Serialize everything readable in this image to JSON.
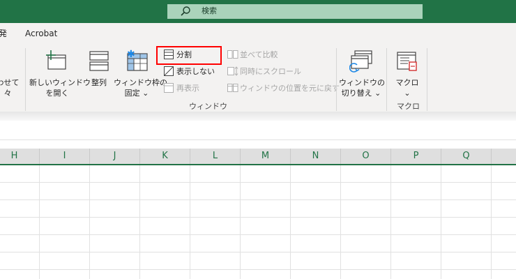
{
  "titlebar": {
    "search_placeholder": "検索",
    "search_icon": "search-icon"
  },
  "menu": {
    "partial_left": "発",
    "acrobat": "Acrobat"
  },
  "ribbon": {
    "partial_left": {
      "line1": "わせて",
      "line2": "々"
    },
    "new_window": {
      "line1": "新しいウィンドウ",
      "line2": "を開く"
    },
    "arrange": {
      "label": "整列"
    },
    "freeze_panes": {
      "line1": "ウィンドウ枠の",
      "line2": "固定 ⌄"
    },
    "split": {
      "label": "分割"
    },
    "hide": {
      "label": "表示しない"
    },
    "unhide": {
      "label": "再表示"
    },
    "side_by_side": {
      "label": "並べて比較"
    },
    "sync_scroll": {
      "label": "同時にスクロール"
    },
    "reset_position": {
      "label": "ウィンドウの位置を元に戻す"
    },
    "switch_window": {
      "line1": "ウィンドウの",
      "line2": "切り替え ⌄"
    },
    "macro": {
      "line1": "マクロ",
      "line2": "⌄"
    },
    "group_window": "ウィンドウ",
    "group_macro": "マクロ"
  },
  "grid": {
    "columns": [
      "H",
      "I",
      "J",
      "K",
      "L",
      "M",
      "N",
      "O",
      "P",
      "Q"
    ]
  },
  "colors": {
    "accent": "#217346",
    "highlight": "#ff0000"
  }
}
